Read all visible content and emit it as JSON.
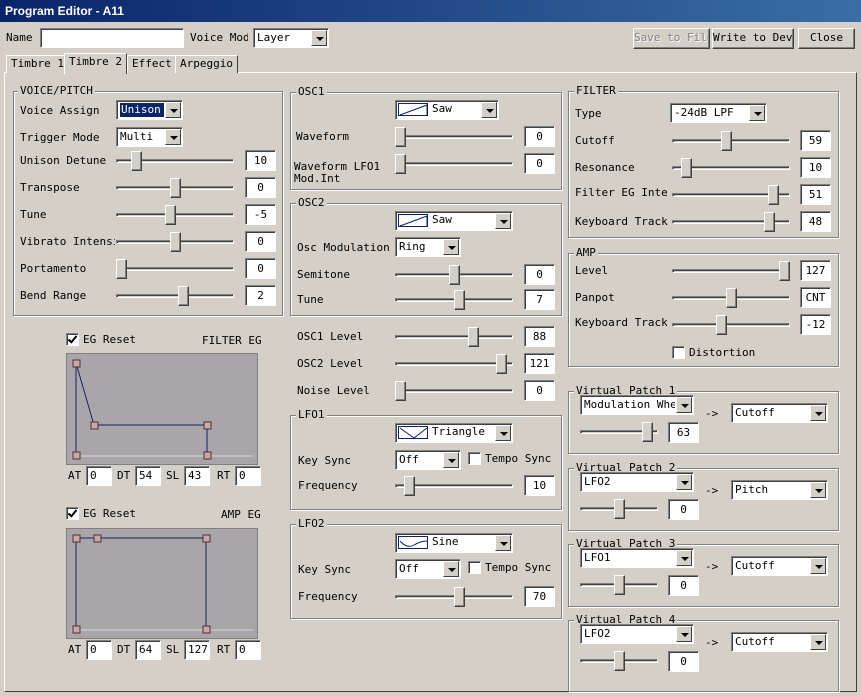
{
  "window": {
    "title": "Program Editor - A11"
  },
  "header": {
    "name_label": "Name",
    "name_value": "",
    "voice_mode_label": "Voice Mode",
    "voice_mode_value": "Layer",
    "save_label": "Save to File",
    "write_label": "Write to Device",
    "close_label": "Close"
  },
  "tabs": [
    "Timbre 1",
    "Timbre 2",
    "Effect",
    "Arpeggio"
  ],
  "active_tab": "Timbre 2",
  "voice_pitch": {
    "title": "VOICE/PITCH",
    "voice_assign": {
      "label": "Voice Assign",
      "value": "Unison"
    },
    "trigger_mode": {
      "label": "Trigger Mode",
      "value": "Multi"
    },
    "sliders": [
      {
        "label": "Unison Detune",
        "value": "10",
        "pos": 0.14
      },
      {
        "label": "Transpose",
        "value": "0",
        "pos": 0.5
      },
      {
        "label": "Tune",
        "value": "-5",
        "pos": 0.46
      },
      {
        "label": "Vibrato Intensity",
        "value": "0",
        "pos": 0.5
      },
      {
        "label": "Portamento",
        "value": "0",
        "pos": 0.0
      },
      {
        "label": "Bend Range",
        "value": "2",
        "pos": 0.58
      }
    ]
  },
  "filter_eg": {
    "reset_label": "EG Reset",
    "reset_checked": true,
    "title": "FILTER EG",
    "at_label": "AT",
    "at": "0",
    "dt_label": "DT",
    "dt": "54",
    "sl_label": "SL",
    "sl": "43",
    "rt_label": "RT",
    "rt": "0"
  },
  "amp_eg": {
    "reset_label": "EG Reset",
    "reset_checked": true,
    "title": "AMP EG",
    "at_label": "AT",
    "at": "0",
    "dt_label": "DT",
    "dt": "64",
    "sl_label": "SL",
    "sl": "127",
    "rt_label": "RT",
    "rt": "0"
  },
  "osc1": {
    "title": "OSC1",
    "wave": "Saw",
    "waveform_label": "Waveform",
    "waveform_value": "0",
    "waveform_pos": 0.0,
    "lfo_label1": "Waveform LFO1",
    "lfo_label2": "Mod.Int",
    "lfo_value": "0",
    "lfo_pos": 0.0
  },
  "osc2": {
    "title": "OSC2",
    "wave": "Saw",
    "mod_label": "Osc Modulation",
    "mod_value": "Ring",
    "semitone_label": "Semitone",
    "semitone_value": "0",
    "semitone_pos": 0.5,
    "tune_label": "Tune",
    "tune_value": "7",
    "tune_pos": 0.55
  },
  "mixer": [
    {
      "label": "OSC1 Level",
      "value": "88",
      "pos": 0.68
    },
    {
      "label": "OSC2 Level",
      "value": "121",
      "pos": 0.94
    },
    {
      "label": "Noise Level",
      "value": "0",
      "pos": 0.0
    }
  ],
  "lfo1": {
    "title": "LFO1",
    "wave": "Triangle",
    "key_sync_label": "Key Sync",
    "key_sync_value": "Off",
    "tempo_sync_label": "Tempo Sync",
    "tempo_sync_checked": false,
    "freq_label": "Frequency",
    "freq_value": "10",
    "freq_pos": 0.08
  },
  "lfo2": {
    "title": "LFO2",
    "wave": "Sine",
    "key_sync_label": "Key Sync",
    "key_sync_value": "Off",
    "tempo_sync_label": "Tempo Sync",
    "tempo_sync_checked": false,
    "freq_label": "Frequency",
    "freq_value": "70",
    "freq_pos": 0.55
  },
  "filter": {
    "title": "FILTER",
    "type_label": "Type",
    "type_value": "-24dB LPF",
    "sliders": [
      {
        "label": "Cutoff",
        "value": "59",
        "pos": 0.46
      },
      {
        "label": "Resonance",
        "value": "10",
        "pos": 0.08
      },
      {
        "label": "Filter EG Intensity",
        "value": "51",
        "pos": 0.9
      },
      {
        "label": "Keyboard Track",
        "value": "48",
        "pos": 0.86
      }
    ]
  },
  "amp": {
    "title": "AMP",
    "sliders": [
      {
        "label": "Level",
        "value": "127",
        "pos": 1.0
      },
      {
        "label": "Panpot",
        "value": "CNT",
        "pos": 0.5
      },
      {
        "label": "Keyboard Track",
        "value": "-12",
        "pos": 0.41
      }
    ],
    "distortion_label": "Distortion",
    "distortion_checked": false
  },
  "virtual_patches": [
    {
      "title": "Virtual Patch 1",
      "source": "Modulation Wheel",
      "dest": "Cutoff",
      "value": "63",
      "pos": 0.92
    },
    {
      "title": "Virtual Patch 2",
      "source": "LFO2",
      "dest": "Pitch",
      "value": "0",
      "pos": 0.5
    },
    {
      "title": "Virtual Patch 3",
      "source": "LFO1",
      "dest": "Cutoff",
      "value": "0",
      "pos": 0.5
    },
    {
      "title": "Virtual Patch 4",
      "source": "LFO2",
      "dest": "Cutoff",
      "value": "0",
      "pos": 0.5
    }
  ],
  "arrow_text": "->",
  "colors": {
    "titlebar": "#0a246a",
    "face": "#d4d0c8",
    "eg_bg": "#a8a6a8",
    "eg_line": "#1c1c6c",
    "selection": "#0a246a"
  },
  "icons": {
    "saw": "saw-wave-icon",
    "triangle": "triangle-wave-icon",
    "sine": "sine-wave-icon"
  }
}
